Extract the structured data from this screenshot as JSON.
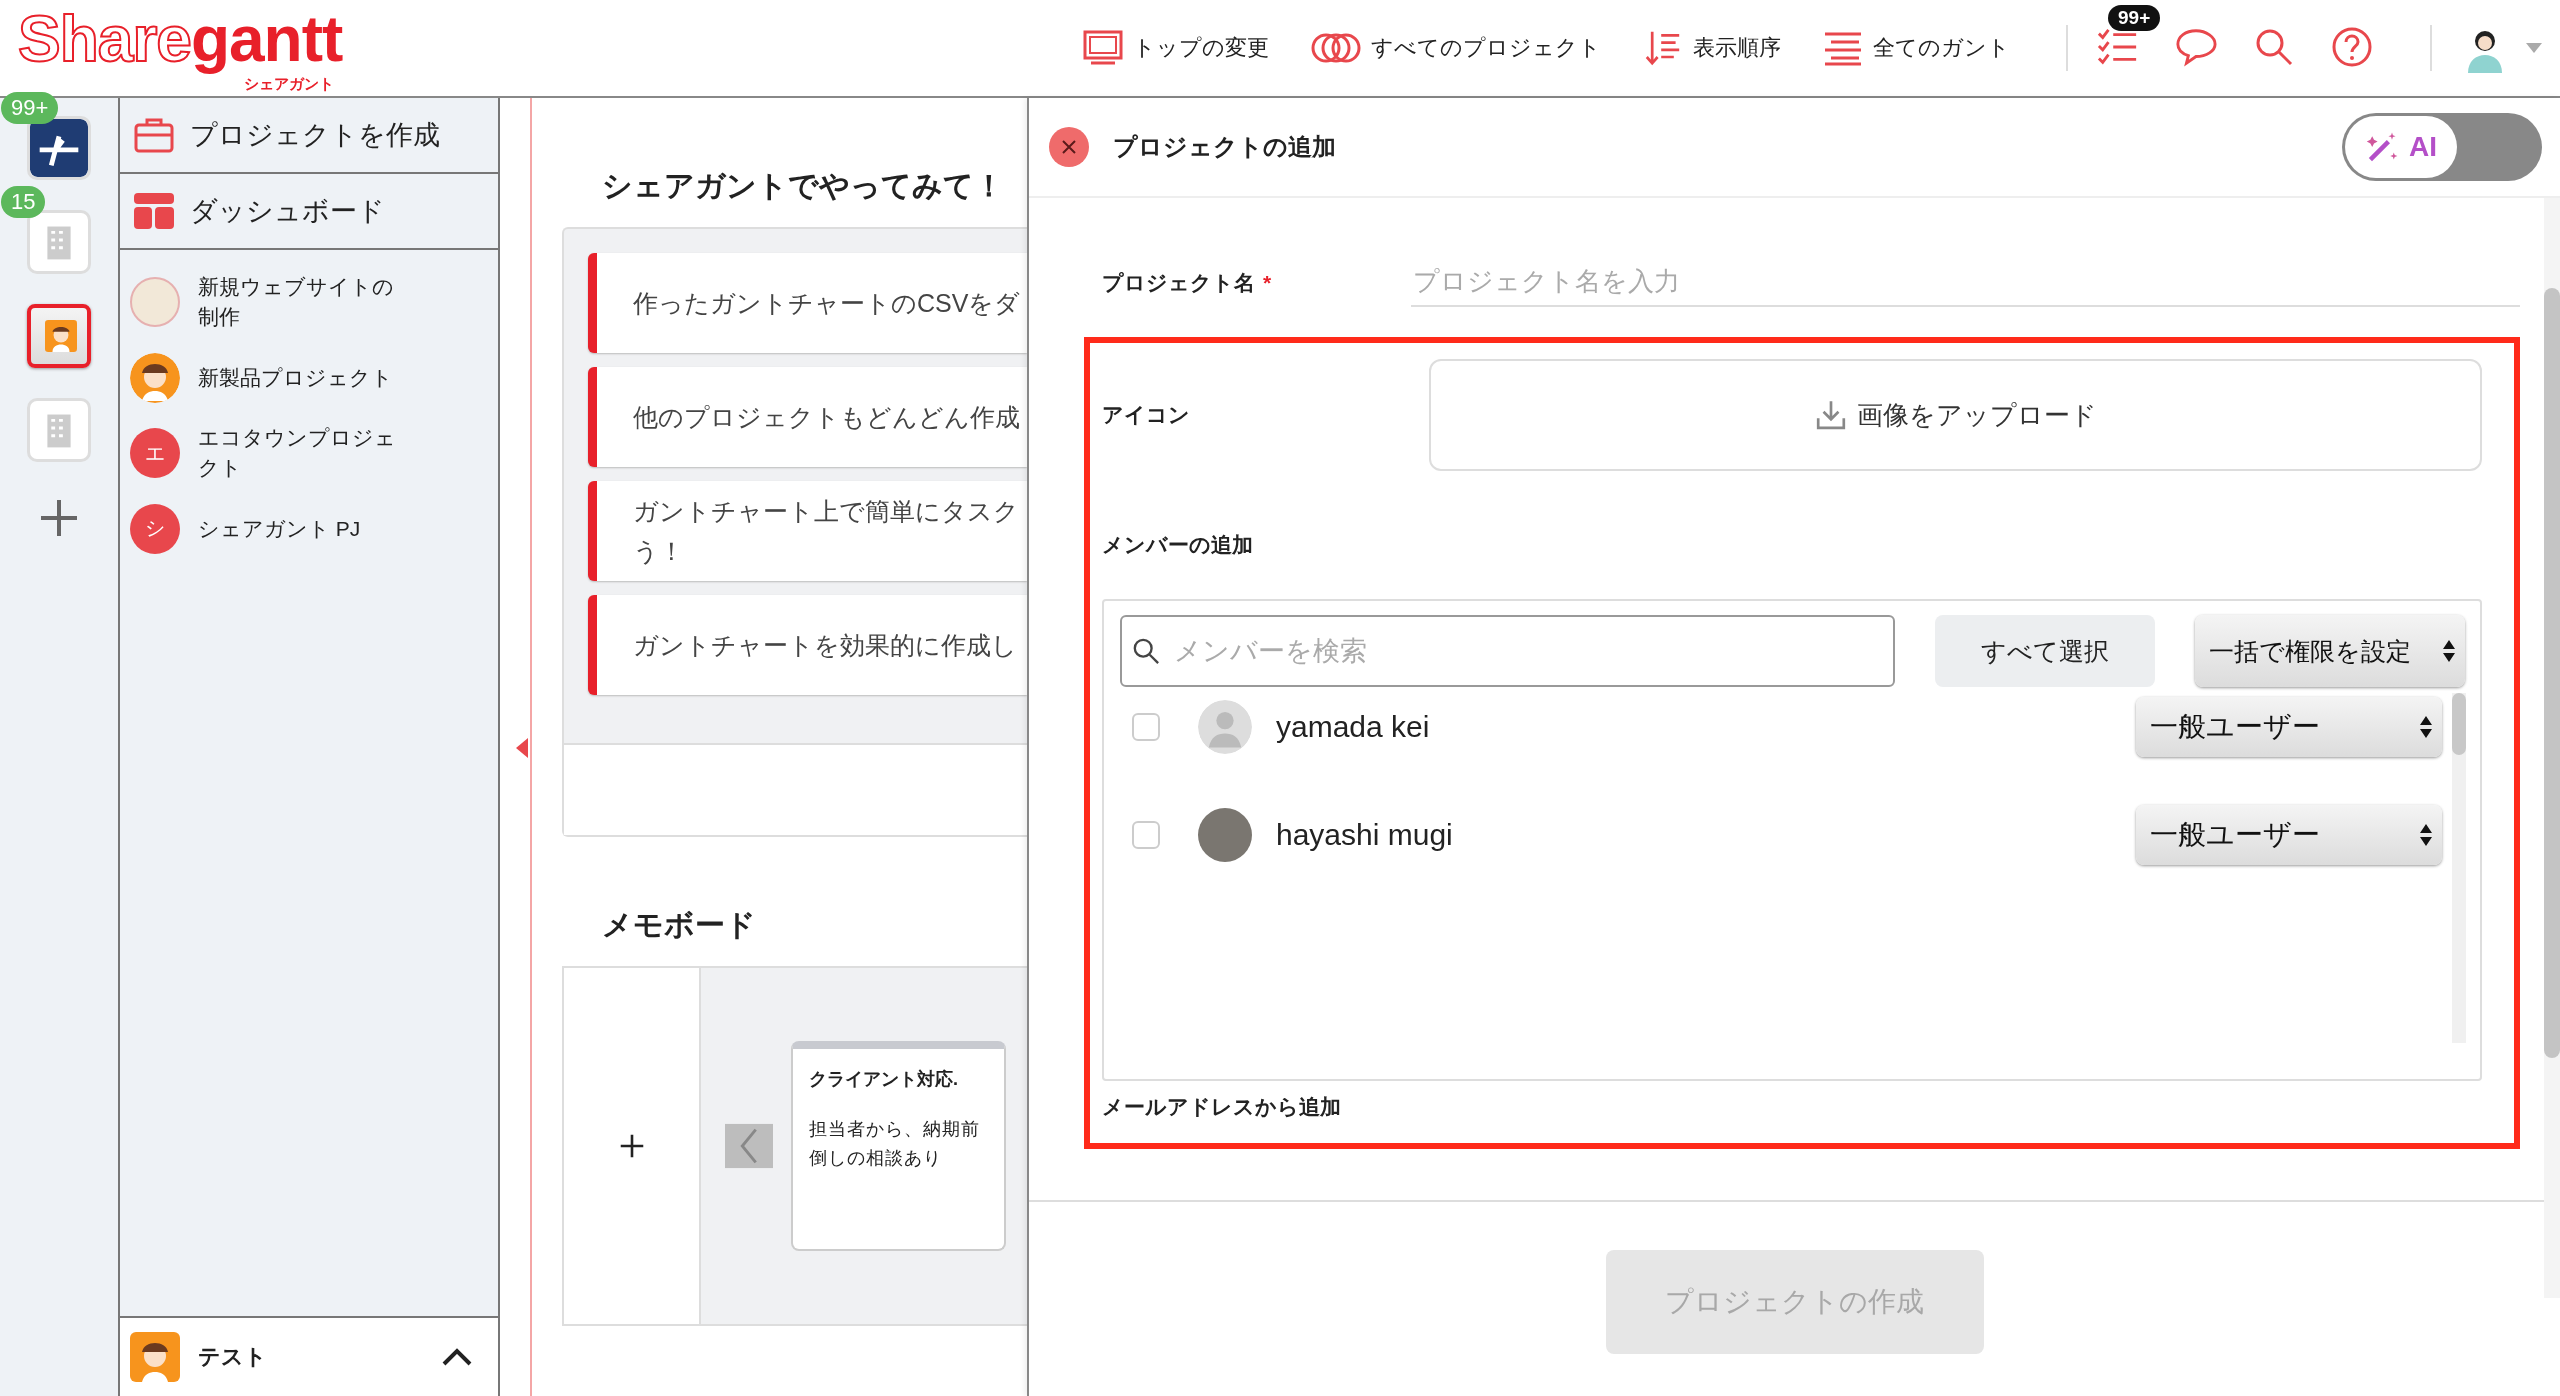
{
  "logo": {
    "outlined": "Share",
    "filled": "gantt",
    "sub": "シェアガント"
  },
  "nav": [
    {
      "label": "トップの変更",
      "kind": "monitor"
    },
    {
      "label": "すべてのプロジェクト",
      "kind": "circles"
    },
    {
      "label": "表示順序",
      "kind": "sort"
    },
    {
      "label": "全てのガント",
      "kind": "lines"
    }
  ],
  "header_icons": [
    {
      "kind": "tasks",
      "badge": "99+"
    },
    {
      "kind": "chat"
    },
    {
      "kind": "search"
    },
    {
      "kind": "help"
    }
  ],
  "rail": [
    {
      "kind": "plane",
      "badge": "99+",
      "selected": false
    },
    {
      "kind": "building",
      "badge": "15",
      "selected": false
    },
    {
      "kind": "character",
      "selected": true
    },
    {
      "kind": "building",
      "selected": false
    }
  ],
  "sidebar": {
    "actions": [
      {
        "label": "プロジェクトを作成",
        "kind": "briefcase"
      },
      {
        "label": "ダッシュボード",
        "kind": "dashboard"
      }
    ],
    "projects": [
      {
        "name": "新規ウェブサイトの制作",
        "kind": "photo"
      },
      {
        "name": "新製品プロジェクト",
        "kind": "character"
      },
      {
        "name": "エコタウンプロジェクト",
        "kind": "letter",
        "letter": "エ",
        "color": "#e8474c"
      },
      {
        "name": "シェアガント PJ",
        "kind": "letter",
        "letter": "シ",
        "color": "#e8474c"
      }
    ],
    "footer": {
      "label": "テスト"
    }
  },
  "tips": {
    "title": "シェアガントでやってみて！",
    "items": [
      {
        "lines": [
          "作ったガントチャートのCSVをダ"
        ]
      },
      {
        "lines": [
          "他のプロジェクトもどんどん作成"
        ]
      },
      {
        "lines": [
          "ガントチャート上で簡単にタスク",
          "う！"
        ]
      },
      {
        "lines": [
          "ガントチャートを効果的に作成し"
        ]
      }
    ]
  },
  "memo": {
    "title": "メモボード",
    "cards": [
      {
        "title": "クライアント対応.",
        "body": "担当者から、納期前倒しの相談あり"
      }
    ]
  },
  "modal": {
    "title": "プロジェクトの追加",
    "ai_toggle": {
      "label": "AI",
      "on": false
    },
    "project_name": {
      "label": "プロジェクト名",
      "required": "*",
      "placeholder": "プロジェクト名を入力"
    },
    "icon": {
      "label": "アイコン",
      "upload": "画像をアップロード"
    },
    "members": {
      "label": "メンバーの追加",
      "search_placeholder": "メンバーを検索",
      "select_all": "すべて選択",
      "bulk_role": "一括で権限を設定",
      "list": [
        {
          "name": "yamada kei",
          "kind": "default",
          "checked": false,
          "role": "一般ユーザー"
        },
        {
          "name": "hayashi mugi",
          "kind": "photo",
          "checked": false,
          "role": "一般ユーザー"
        }
      ]
    },
    "email_label": "メールアドレスから追加",
    "submit": {
      "label": "プロジェクトの作成",
      "disabled": true
    }
  }
}
